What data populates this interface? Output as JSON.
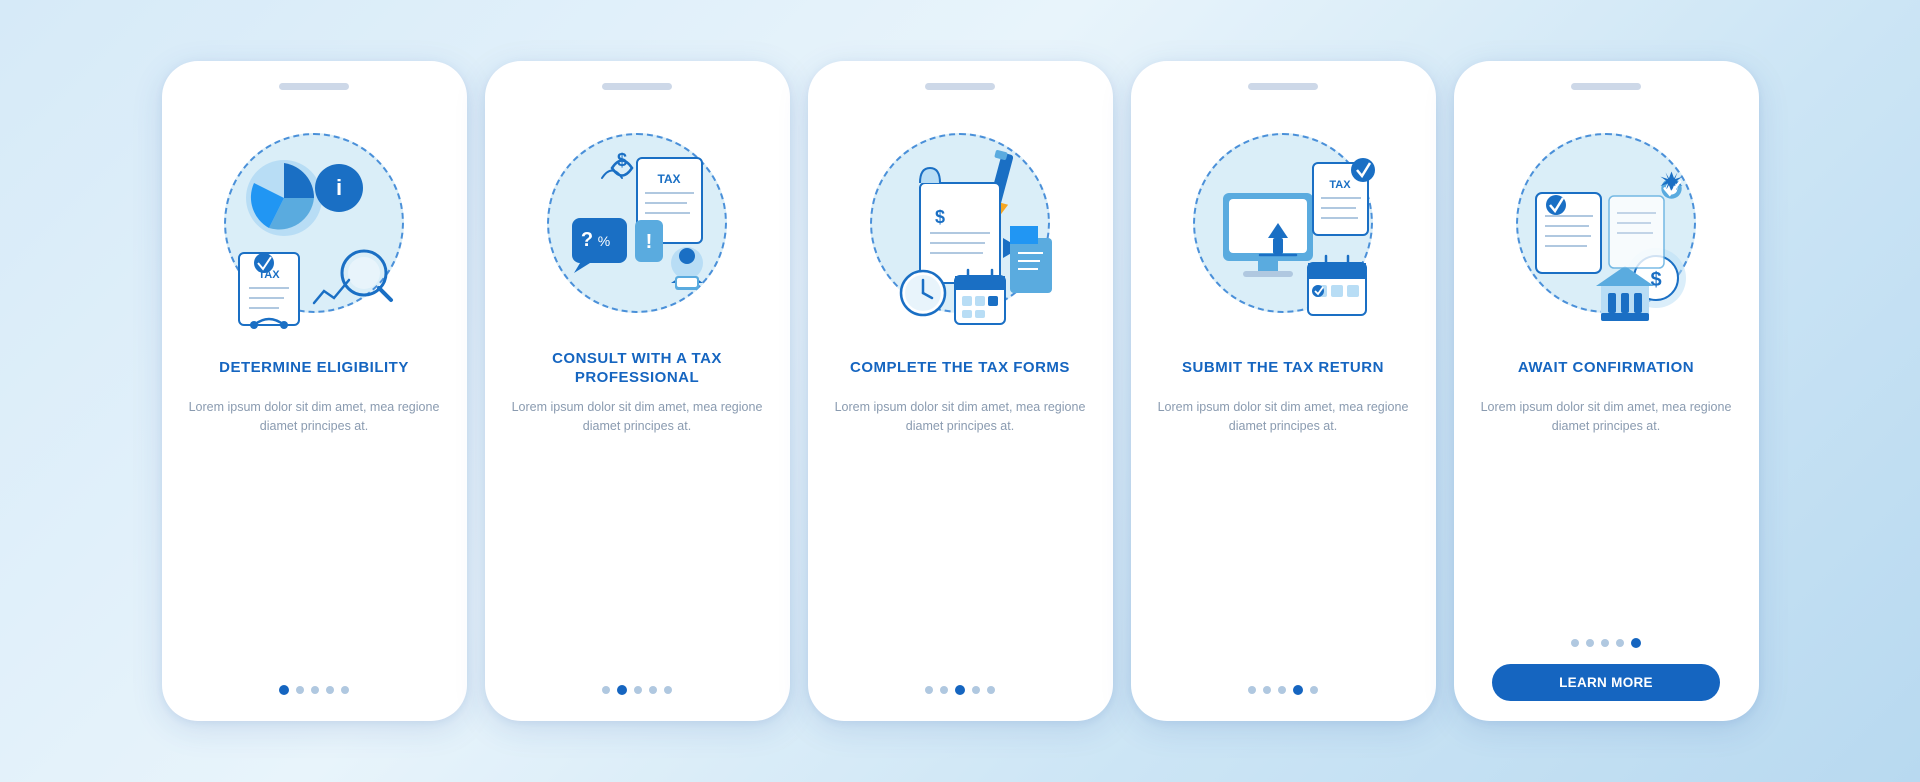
{
  "cards": [
    {
      "id": "card-1",
      "title": "DETERMINE ELIGIBILITY",
      "description": "Lorem ipsum dolor sit dim amet, mea regione diamet principes at.",
      "dots": [
        true,
        false,
        false,
        false,
        false
      ],
      "active_dot": 0,
      "has_button": false,
      "icon": "eligibility"
    },
    {
      "id": "card-2",
      "title": "CONSULT WITH A TAX PROFESSIONAL",
      "description": "Lorem ipsum dolor sit dim amet, mea regione diamet principes at.",
      "dots": [
        false,
        true,
        false,
        false,
        false
      ],
      "active_dot": 1,
      "has_button": false,
      "icon": "consult"
    },
    {
      "id": "card-3",
      "title": "COMPLETE THE TAX FORMS",
      "description": "Lorem ipsum dolor sit dim amet, mea regione diamet principes at.",
      "dots": [
        false,
        false,
        true,
        false,
        false
      ],
      "active_dot": 2,
      "has_button": false,
      "icon": "complete"
    },
    {
      "id": "card-4",
      "title": "SUBMIT THE TAX RETURN",
      "description": "Lorem ipsum dolor sit dim amet, mea regione diamet principes at.",
      "dots": [
        false,
        false,
        false,
        true,
        false
      ],
      "active_dot": 3,
      "has_button": false,
      "icon": "submit"
    },
    {
      "id": "card-5",
      "title": "AWAIT CONFIRMATION",
      "description": "Lorem ipsum dolor sit dim amet, mea regione diamet principes at.",
      "dots": [
        false,
        false,
        false,
        false,
        true
      ],
      "active_dot": 4,
      "has_button": true,
      "button_label": "LEARN MORE",
      "icon": "await"
    }
  ]
}
